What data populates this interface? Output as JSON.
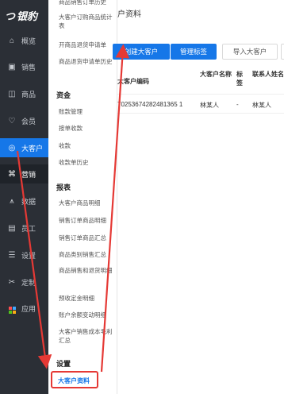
{
  "app": {
    "logo_text": "银豹"
  },
  "page": {
    "title": "户资料"
  },
  "sidebar": {
    "items": [
      {
        "label": "概览",
        "icon": "home-icon"
      },
      {
        "label": "销售",
        "icon": "sales-icon"
      },
      {
        "label": "商品",
        "icon": "product-icon"
      },
      {
        "label": "会员",
        "icon": "member-icon"
      },
      {
        "label": "大客户",
        "icon": "vip-customer-icon"
      },
      {
        "label": "营销",
        "icon": "marketing-icon"
      },
      {
        "label": "数据",
        "icon": "data-icon"
      },
      {
        "label": "员工",
        "icon": "staff-icon"
      },
      {
        "label": "设置",
        "icon": "settings-icon"
      },
      {
        "label": "定制",
        "icon": "custom-icon"
      },
      {
        "label": "应用",
        "icon": "apps-icon"
      }
    ]
  },
  "submenu": {
    "items_top": [
      "商品销售订单历史",
      "大客户订购商品统计表",
      "开商品退货申请单",
      "商品退货申请单历史"
    ],
    "section_finance": "资金",
    "items_finance": [
      "账款管理",
      "按单收款",
      "收款",
      "收款单历史"
    ],
    "section_report": "报表",
    "items_report": [
      "大客户商品明细",
      "销售订单商品明细",
      "销售订单商品汇总",
      "商品类别销售汇总",
      "商品销售和退货明细",
      "预收定金明细",
      "账户余额变动明细",
      "大客户销售成本毛利汇总"
    ],
    "section_settings": "设置",
    "selected": "大客户资料"
  },
  "toolbar": {
    "create_label": "创建大客户",
    "tag_label": "管理标签",
    "import_label": "导入大客户"
  },
  "table": {
    "headers": [
      "大客户编码",
      "大客户名称",
      "标签",
      "联系人姓名"
    ],
    "rows": [
      {
        "code": "70253674282481365 1",
        "name": "林某人",
        "tag": "-",
        "contact": "林某人"
      }
    ]
  },
  "annotation": {
    "color": "#e53935"
  }
}
